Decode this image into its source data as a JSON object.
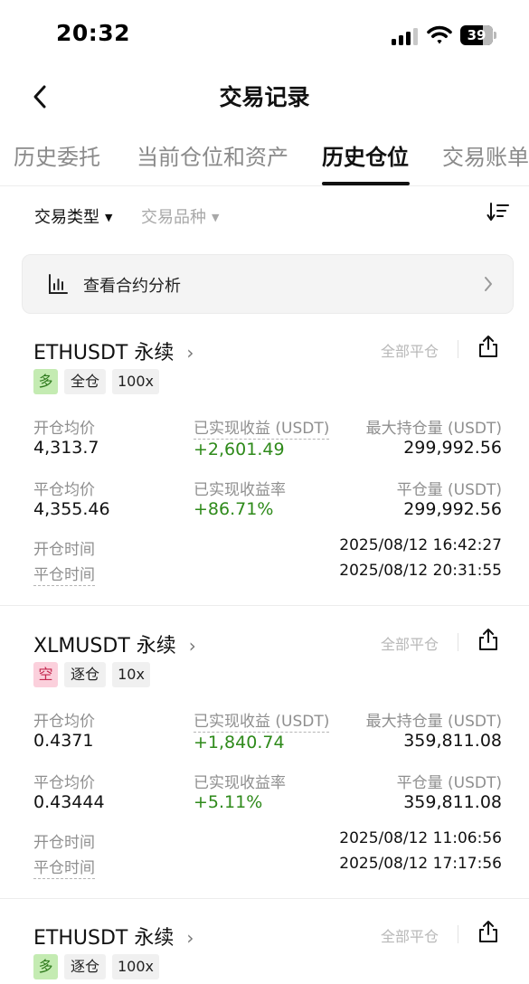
{
  "status": {
    "time": "20:32",
    "battery": "39"
  },
  "nav": {
    "title": "交易记录"
  },
  "tabs": [
    "历史委托",
    "当前仓位和资产",
    "历史仓位",
    "交易账单"
  ],
  "filters": {
    "trade_type": "交易类型",
    "instrument": "交易品种"
  },
  "analysis": {
    "label": "查看合约分析"
  },
  "labels": {
    "open_avg": "开仓均价",
    "close_avg": "平仓均价",
    "realized_pnl": "已实现收益 (USDT)",
    "realized_pnl_rate": "已实现收益率",
    "max_position": "最大持仓量 (USDT)",
    "close_volume": "平仓量 (USDT)",
    "open_time": "开仓时间",
    "close_time": "平仓时间",
    "close_all": "全部平仓"
  },
  "positions": [
    {
      "symbol": "ETHUSDT 永续",
      "side": "多",
      "margin_mode": "全仓",
      "leverage": "100x",
      "open_avg": "4,313.7",
      "close_avg": "4,355.46",
      "realized_pnl": "+2,601.49",
      "realized_pnl_rate": "+86.71%",
      "max_position": "299,992.56",
      "close_volume": "299,992.56",
      "open_time": "2025/08/12 16:42:27",
      "close_time": "2025/08/12 20:31:55"
    },
    {
      "symbol": "XLMUSDT 永续",
      "side": "空",
      "margin_mode": "逐仓",
      "leverage": "10x",
      "open_avg": "0.4371",
      "close_avg": "0.43444",
      "realized_pnl": "+1,840.74",
      "realized_pnl_rate": "+5.11%",
      "max_position": "359,811.08",
      "close_volume": "359,811.08",
      "open_time": "2025/08/12 11:06:56",
      "close_time": "2025/08/12 17:17:56"
    },
    {
      "symbol": "ETHUSDT 永续",
      "side": "多",
      "margin_mode": "逐仓",
      "leverage": "100x"
    }
  ]
}
